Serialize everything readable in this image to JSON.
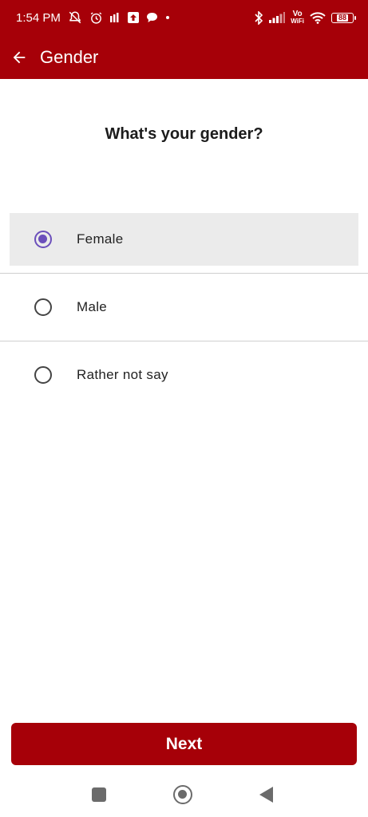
{
  "status_bar": {
    "time": "1:54 PM",
    "icons_left": [
      "mute-notification-icon",
      "alarm-icon",
      "signal-bars-icon",
      "upload-icon",
      "chat-bubble-icon",
      "dot-icon"
    ],
    "icons_right": [
      "bluetooth-icon",
      "cell-signal-icon",
      "vowifi-icon",
      "wifi-icon",
      "battery-icon"
    ],
    "vowifi_top": "Vo",
    "vowifi_bottom": "WiFi",
    "battery_level": "88"
  },
  "app_bar": {
    "title": "Gender",
    "back_icon": "arrow-left-icon"
  },
  "question": "What's your gender?",
  "options": [
    {
      "label": "Female",
      "selected": true
    },
    {
      "label": "Male",
      "selected": false
    },
    {
      "label": "Rather not say",
      "selected": false
    }
  ],
  "next_button": "Next",
  "colors": {
    "brand": "#a60008",
    "radio_selected": "#6b4fbb",
    "selected_row_bg": "#ebebeb"
  },
  "nav_bar": {
    "icons": [
      "recents-square-icon",
      "home-circle-icon",
      "back-triangle-icon"
    ]
  }
}
